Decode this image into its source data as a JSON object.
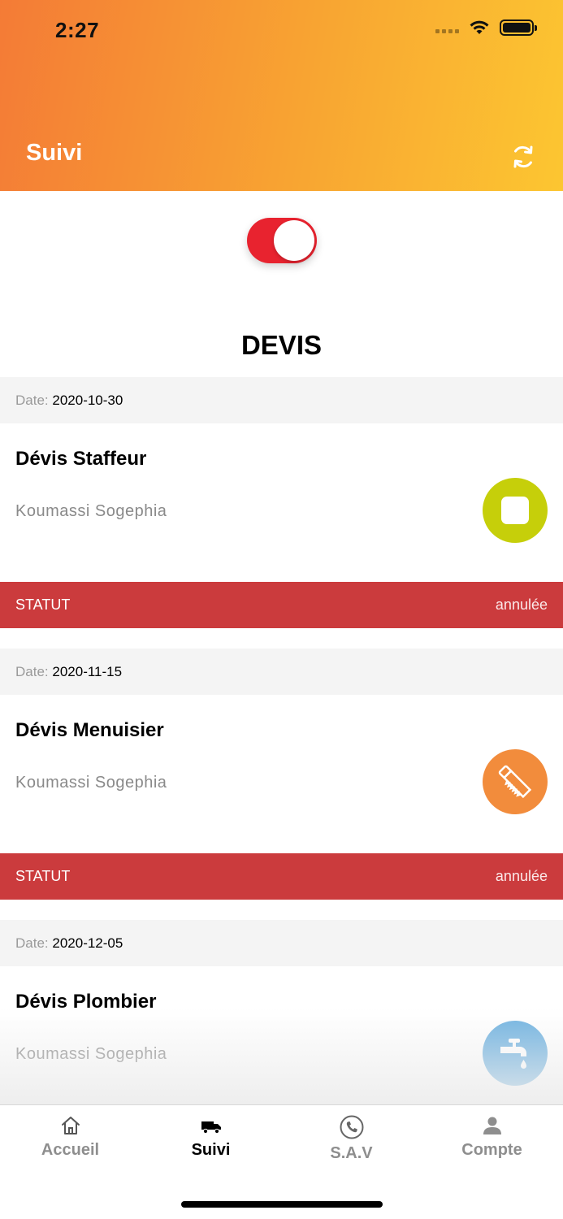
{
  "status_bar": {
    "time": "2:27"
  },
  "header": {
    "title": "Suivi",
    "refresh_icon": "refresh-icon"
  },
  "toggle": {
    "state": "on",
    "color": "#e8232f"
  },
  "section": {
    "title": "DEVIS"
  },
  "cards": [
    {
      "date_label": "Date:",
      "date": "2020-10-30",
      "title": "Dévis Staffeur",
      "location": "Koumassi Sogephia",
      "icon": "square-icon",
      "icon_color": "#c6cf0a",
      "status_label": "STATUT",
      "status": "annulée"
    },
    {
      "date_label": "Date:",
      "date": "2020-11-15",
      "title": "Dévis Menuisier",
      "location": "Koumassi Sogephia",
      "icon": "saw-icon",
      "icon_color": "#f28c3c",
      "status_label": "STATUT",
      "status": "annulée"
    },
    {
      "date_label": "Date:",
      "date": "2020-12-05",
      "title": "Dévis Plombier",
      "location": "Koumassi Sogephia",
      "icon": "faucet-icon",
      "icon_color": "#6fb2e0"
    }
  ],
  "tabs": [
    {
      "label": "Accueil",
      "icon": "home-icon",
      "active": false
    },
    {
      "label": "Suivi",
      "icon": "truck-icon",
      "active": true
    },
    {
      "label": "S.A.V",
      "icon": "phone-icon",
      "active": false
    },
    {
      "label": "Compte",
      "icon": "user-icon",
      "active": false
    }
  ],
  "colors": {
    "header_start": "#f47b36",
    "header_end": "#fcc631",
    "status_bar": "#cb3b3d"
  }
}
